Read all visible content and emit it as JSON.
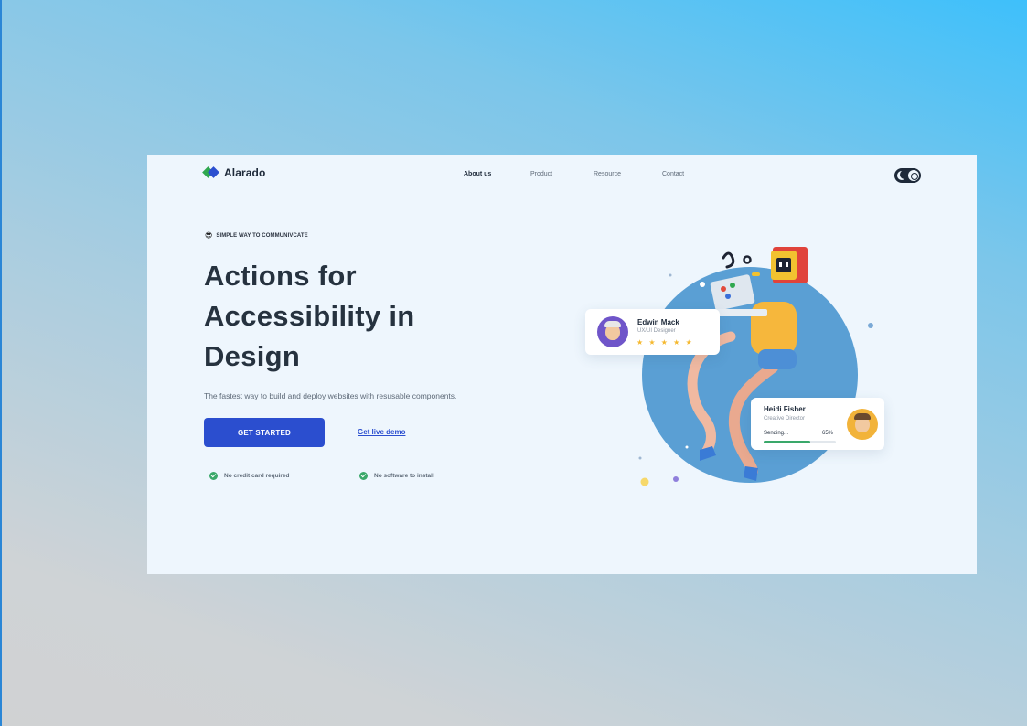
{
  "brand": {
    "name": "Alarado"
  },
  "nav": {
    "items": [
      {
        "label": "About us",
        "active": true
      },
      {
        "label": "Product",
        "active": false
      },
      {
        "label": "Resource",
        "active": false
      },
      {
        "label": "Contact",
        "active": false
      }
    ],
    "theme_toggle_icon": "moon-sun-toggle-icon"
  },
  "hero": {
    "eyebrow": "SIMPLE WAY TO COMMUNIVCATE",
    "headline_lines": [
      "Actions for",
      "Accessibility in",
      "Design"
    ],
    "subtitle": "The fastest way to build and deploy websites with resusable components.",
    "cta_label": "GET STARTED",
    "demo_label": "Get live demo",
    "checks": [
      "No credit card required",
      "No software to install"
    ]
  },
  "cards": {
    "edwin": {
      "name": "Edwin Mack",
      "role": "UX/UI Designer",
      "stars": "★ ★ ★ ★ ★",
      "rating": 5
    },
    "heidi": {
      "name": "Heidi Fisher",
      "role": "Creative Director",
      "status": "Sending...",
      "progress_label": "65%",
      "progress": 0.65
    }
  },
  "colors": {
    "accent": "#2b4ecf",
    "success": "#3aa86a",
    "text": "#26323f",
    "circle": "#5a9fd4",
    "star": "#f5b82e"
  }
}
